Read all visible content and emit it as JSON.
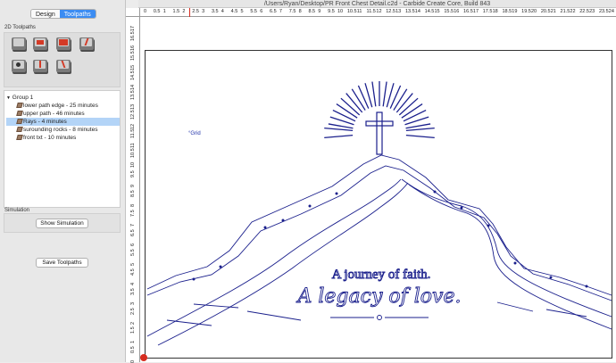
{
  "window": {
    "title": "/Users/Ryan/Desktop/PR Front Chest Detail.c2d - Carbide Create Core, Build 843"
  },
  "tabs": [
    {
      "label": "Design"
    },
    {
      "label": "Toolpaths"
    }
  ],
  "toolpaths_section": {
    "label": "2D Toolpaths"
  },
  "toolpath_tree": {
    "group": "Group 1",
    "items": [
      {
        "label": "lower path edge - 25 minutes"
      },
      {
        "label": "upper path - 46 minutes"
      },
      {
        "label": "Rays - 4 minutes"
      },
      {
        "label": "surounding rocks - 8 minutes"
      },
      {
        "label": "front txt - 10 minutes"
      }
    ]
  },
  "simulation": {
    "label": "Simulation",
    "show_button": "Show Simulation",
    "save_button": "Save Toolpaths"
  },
  "canvas": {
    "grid_label": "Grid",
    "text_line1": "A journey of faith.",
    "text_line2": "A legacy of love.",
    "accent_color": "#1a1f8c"
  },
  "rulers": {
    "top": [
      "0",
      "0.5",
      "1",
      "1.5",
      "2",
      "2.5",
      "3",
      "3.5",
      "4",
      "4.5",
      "5",
      "5.5",
      "6",
      "6.5",
      "7",
      "7.5",
      "8",
      "8.5",
      "9",
      "9.5",
      "10",
      "10.5",
      "11",
      "11.5",
      "12",
      "12.5",
      "13",
      "13.5",
      "14",
      "14.5",
      "15",
      "15.5",
      "16",
      "16.5",
      "17",
      "17.5",
      "18",
      "18.5",
      "19",
      "19.5",
      "20",
      "20.5",
      "21",
      "21.5",
      "22",
      "22.5",
      "23",
      "23.5",
      "24"
    ],
    "left": [
      "17",
      "16.5",
      "16",
      "15.5",
      "15",
      "14.5",
      "14",
      "13.5",
      "13",
      "12.5",
      "12",
      "11.5",
      "11",
      "10.5",
      "10",
      "9.5",
      "9",
      "8.5",
      "8",
      "7.5",
      "7",
      "6.5",
      "6",
      "5.5",
      "5",
      "4.5",
      "4",
      "3.5",
      "3",
      "2.5",
      "2",
      "1.5",
      "1",
      "0.5",
      "0"
    ]
  }
}
